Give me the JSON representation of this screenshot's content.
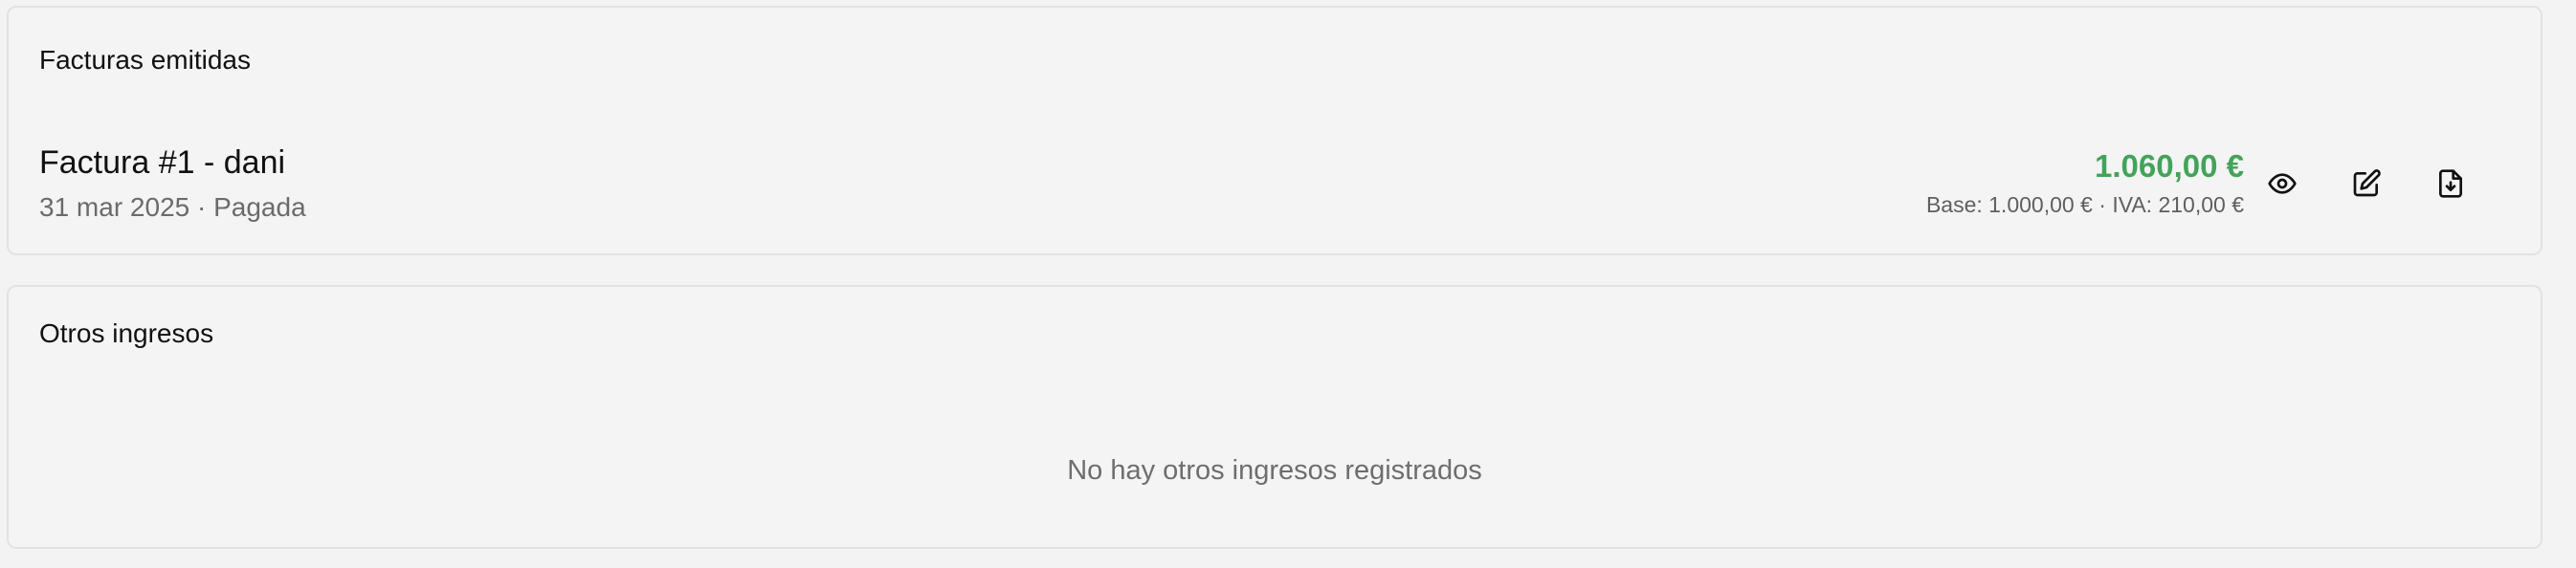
{
  "issued_invoices": {
    "title": "Facturas emitidas",
    "invoices": [
      {
        "title": "Factura #1 - dani",
        "date": "31 mar 2025",
        "separator": " · ",
        "status": "Pagada",
        "total": "1.060,00 €",
        "base_label": "Base: 1.000,00 €",
        "iva_label": "IVA: 210,00 €",
        "actions": [
          {
            "icon": "eye-icon"
          },
          {
            "icon": "edit-icon"
          },
          {
            "icon": "download-file-icon"
          }
        ]
      }
    ]
  },
  "other_income": {
    "title": "Otros ingresos",
    "empty_message": "No hay otros ingresos registrados"
  },
  "colors": {
    "total_amount": "#44a35a",
    "muted_text": "#6b6b6b",
    "card_background": "#f4f4f4",
    "card_border": "#e2e2e2"
  }
}
